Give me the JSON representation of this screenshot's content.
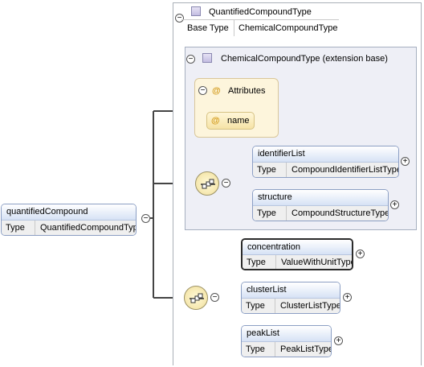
{
  "complex_type": {
    "name": "QuantifiedCompoundType",
    "base_type_label": "Base Type",
    "base_type_value": "ChemicalCompoundType"
  },
  "extension": {
    "label": "ChemicalCompoundType (extension base)"
  },
  "attributes": {
    "label": "Attributes",
    "items": [
      {
        "name": "name"
      }
    ]
  },
  "root_element": {
    "name": "quantifiedCompound",
    "type_label": "Type",
    "type_value": "QuantifiedCompoundType"
  },
  "ext_elements": [
    {
      "name": "identifierList",
      "type_label": "Type",
      "type_value": "CompoundIdentifierListType"
    },
    {
      "name": "structure",
      "type_label": "Type",
      "type_value": "CompoundStructureType"
    }
  ],
  "own_elements": [
    {
      "name": "concentration",
      "type_label": "Type",
      "type_value": "ValueWithUnitType"
    },
    {
      "name": "clusterList",
      "type_label": "Type",
      "type_value": "ClusterListType"
    },
    {
      "name": "peakList",
      "type_label": "Type",
      "type_value": "PeakListType"
    }
  ],
  "symbols": {
    "minus": "−",
    "plus": "+",
    "at": "@"
  },
  "colors": {
    "connector": "#444444",
    "light_connector": "#c8c8c8",
    "element_header": "#d6e2f5"
  }
}
